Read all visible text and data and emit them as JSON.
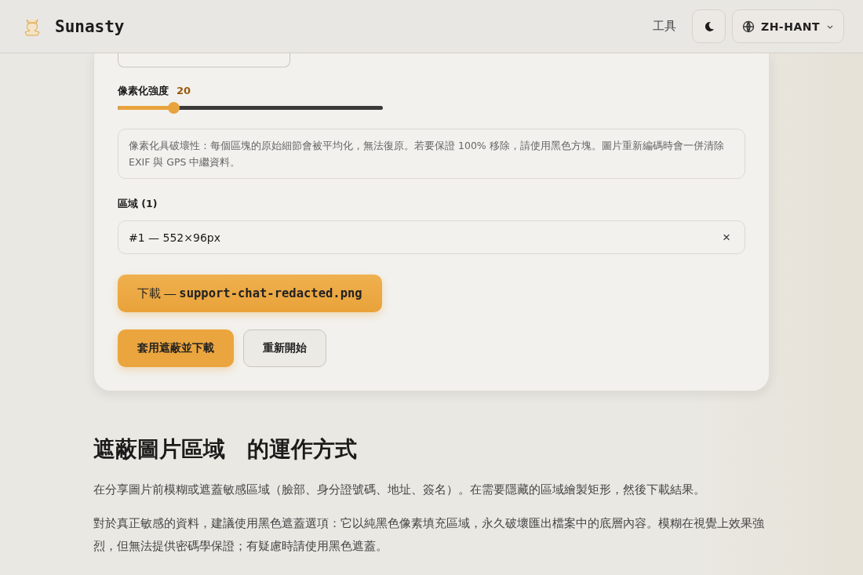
{
  "header": {
    "brand": "Sunasty",
    "nav_link": "工具",
    "language": "ZH-HANT"
  },
  "strength": {
    "label": "像素化強度",
    "reading": "20",
    "level": 0.21
  },
  "note": "像素化具破壞性：每個區塊的原始細節會被平均化，無法復原。若要保證 100% 移除，請使用黑色方塊。圖片重新編碼時會一併清除 EXIF 與 GPS 中繼資料。",
  "regions": {
    "label": "區域 (1)",
    "items": [
      {
        "text": "#1 — 552×96px",
        "remove": "×"
      }
    ]
  },
  "download": {
    "prefix": "下載 —",
    "filename": "support-chat-redacted.png"
  },
  "buttons": [
    {
      "label": "套用遮蔽並下載",
      "kind": "primary"
    },
    {
      "label": "重新開始",
      "kind": "secondary"
    }
  ],
  "section": {
    "title": "遮蔽圖片區域　的運作方式",
    "paragraphs": [
      "在分享圖片前模糊或遮蓋敏感區域（臉部、身分證號碼、地址、簽名）。在需要隱藏的區域繪製矩形，然後下載結果。",
      "對於真正敏感的資料，建議使用黑色遮蓋選項：它以純黑色像素填充區域，永久破壞匯出檔案中的底層內容。模糊在視覺上效果強烈，但無法提供密碼學保證；有疑慮時請使用黑色遮蓋。"
    ]
  }
}
